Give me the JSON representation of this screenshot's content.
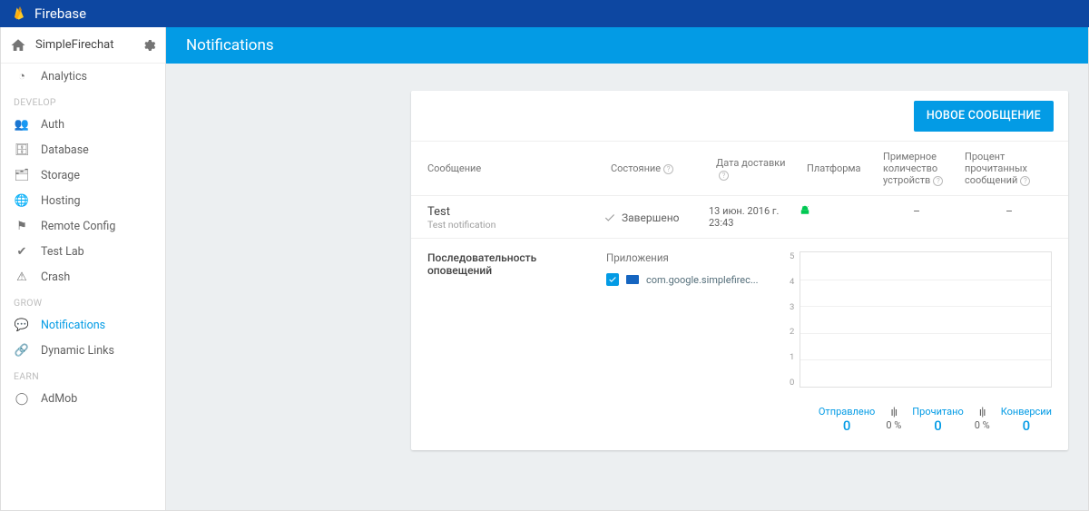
{
  "brand": "Firebase",
  "project": {
    "name": "SimpleFirechat"
  },
  "sidebar": {
    "analytics": "Analytics",
    "groups": {
      "develop": "DEVELOP",
      "grow": "GROW",
      "earn": "EARN"
    },
    "develop": [
      "Auth",
      "Database",
      "Storage",
      "Hosting",
      "Remote Config",
      "Test Lab",
      "Crash"
    ],
    "grow": [
      "Notifications",
      "Dynamic Links"
    ],
    "earn": [
      "AdMob"
    ],
    "activeIndexGrow": 0
  },
  "header": {
    "title": "Notifications"
  },
  "toolbar": {
    "new_message": "НОВОЕ СООБЩЕНИЕ"
  },
  "table": {
    "headers": {
      "message": "Сообщение",
      "status": "Состояние",
      "delivery": "Дата доставки",
      "platform": "Платформа",
      "devices": "Примерное количество устройств",
      "readpct": "Процент прочитанных сообщений"
    },
    "row": {
      "title": "Test",
      "subtitle": "Test notification",
      "status": "Завершено",
      "date_line1": "13 июн. 2016 г.",
      "date_line2": "23:43",
      "devices": "–",
      "readpct": "–"
    }
  },
  "detail": {
    "sequence_label": "Последовательность оповещений",
    "apps_label": "Приложения",
    "app_id": "com.google.simplefirec..."
  },
  "chart_data": {
    "type": "line",
    "title": "",
    "xlabel": "",
    "ylabel": "",
    "ylim": [
      0.0,
      5.0
    ],
    "yticks": [
      5.0,
      4.0,
      3.0,
      2.0,
      1.0,
      0.0
    ],
    "series": [
      {
        "name": "Отправлено",
        "values": []
      },
      {
        "name": "Прочитано",
        "values": []
      },
      {
        "name": "Конверсии",
        "values": []
      }
    ]
  },
  "stats": {
    "sent": {
      "label": "Отправлено",
      "value": "0"
    },
    "read": {
      "label": "Прочитано",
      "value": "0"
    },
    "conv": {
      "label": "Конверсии",
      "value": "0"
    },
    "conv_rate1": "0 %",
    "conv_rate2": "0 %"
  }
}
